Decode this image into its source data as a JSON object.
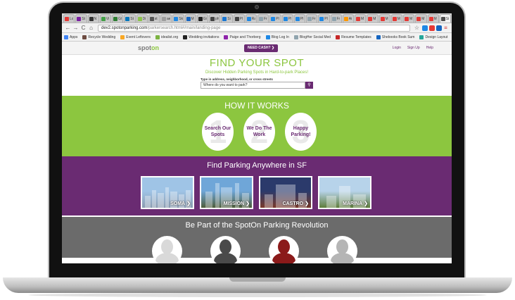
{
  "browser": {
    "tabs": [
      {
        "label": "Lo",
        "color": "#e53935"
      },
      {
        "label": "St",
        "color": "#7b1fa2"
      },
      {
        "label": "N",
        "color": "#333333"
      },
      {
        "label": "Vi",
        "color": "#43a047"
      },
      {
        "label": "Gl",
        "color": "#2e7d32"
      },
      {
        "label": "St",
        "color": "#0277bd"
      },
      {
        "label": "Di",
        "color": "#8bc34a"
      },
      {
        "label": "st",
        "color": "#555555"
      },
      {
        "label": "ae",
        "color": "#9e9e9e"
      },
      {
        "label": "Sk",
        "color": "#1e88e5"
      },
      {
        "label": "M",
        "color": "#1565c0"
      },
      {
        "label": "Gi",
        "color": "#212121"
      },
      {
        "label": "ph",
        "color": "#444444"
      },
      {
        "label": "Si",
        "color": "#1976d2"
      },
      {
        "label": "Pl",
        "color": "#424242"
      },
      {
        "label": "Ra",
        "color": "#1e88e5"
      },
      {
        "label": "Fr",
        "color": "#90a4ae"
      },
      {
        "label": "Pl",
        "color": "#1e88e5"
      },
      {
        "label": "Pl",
        "color": "#1e88e5"
      },
      {
        "label": "Pl",
        "color": "#1e88e5"
      },
      {
        "label": "Fr",
        "color": "#90a4ae"
      },
      {
        "label": "Pl",
        "color": "#1e88e5"
      },
      {
        "label": "Fr",
        "color": "#90a4ae"
      },
      {
        "label": "Ai",
        "color": "#ff9800"
      },
      {
        "label": "M",
        "color": "#e53935"
      },
      {
        "label": "M",
        "color": "#e53935"
      },
      {
        "label": "M",
        "color": "#e53935"
      },
      {
        "label": "M",
        "color": "#e53935"
      },
      {
        "label": "M",
        "color": "#e53935"
      },
      {
        "label": "M",
        "color": "#e53935"
      },
      {
        "label": "M",
        "color": "#e53935"
      },
      {
        "label": "Si",
        "color": "#4e4e4e"
      }
    ],
    "url_host": "dev2.spotonparking.com",
    "url_path": "/parkersearch.html#/main/landing-page",
    "bookmarks": [
      {
        "label": "Apps",
        "color": "#4285f4"
      },
      {
        "label": "Recycle Wedding",
        "color": "#6d4c41"
      },
      {
        "label": "Event Leftovers",
        "color": "#f9a825"
      },
      {
        "label": "idealist.org",
        "color": "#7cb342"
      },
      {
        "label": "Wedding invitations",
        "color": "#212121"
      },
      {
        "label": "Paige and Thorberg",
        "color": "#8e24aa"
      },
      {
        "label": "Blog Log In",
        "color": "#1e88e5"
      },
      {
        "label": "BlogHer Social Med",
        "color": "#90a4ae"
      },
      {
        "label": "Resume Templates",
        "color": "#c62828"
      },
      {
        "label": "Shebooks Book Sum",
        "color": "#1565c0"
      },
      {
        "label": "Design Layout",
        "color": "#26a69a"
      }
    ]
  },
  "site": {
    "logo_a": "spot",
    "logo_b": "on",
    "cash_button": "NEED CASH? ❯",
    "nav": {
      "login": "Login",
      "signup": "Sign Up",
      "help": "Help"
    },
    "hero": {
      "title": "FIND YOUR SPOT",
      "subtitle": "Discover Hidden Parking Spots in Hard-to-park Places!",
      "search_label": "Type in address, neighborhood, or cross streets",
      "search_placeholder": "Where do you want to park?"
    },
    "how": {
      "title": "HOW IT WORKS",
      "steps": [
        {
          "num": "1",
          "text": "Search Our Spots"
        },
        {
          "num": "2",
          "text": "We Do The Work"
        },
        {
          "num": "3",
          "text": "Happy Parking!"
        }
      ]
    },
    "find": {
      "title": "Find Parking Anywhere in SF",
      "hoods": [
        {
          "label": "SOMA",
          "sky": "#9fc4e6",
          "ground": "#8a9bb0"
        },
        {
          "label": "MISSION",
          "sky": "#6fa6d8",
          "ground": "#4e5d3a"
        },
        {
          "label": "CASTRO",
          "sky": "#2b3a6b",
          "ground": "#7a3a2a"
        },
        {
          "label": "MARINA",
          "sky": "#b7d3ea",
          "ground": "#5e7d3a"
        }
      ]
    },
    "revo": {
      "title": "Be Part of the SpotOn Parking Revolution",
      "avatar_colors": [
        "#d9d9d9",
        "#4a4a4a",
        "#8b1a1a",
        "#b5b5b5"
      ]
    }
  }
}
